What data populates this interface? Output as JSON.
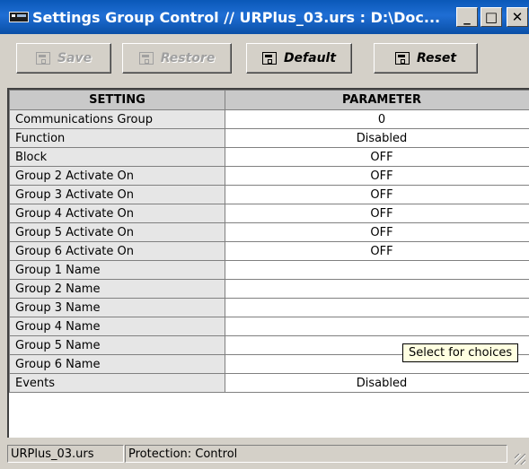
{
  "window": {
    "title": "Settings Group Control // URPlus_03.urs : D:\\Doc...",
    "minimize_label": "_",
    "maximize_label": "□",
    "close_label": "✕"
  },
  "toolbar": {
    "save_label": "Save",
    "restore_label": "Restore",
    "default_label": "Default",
    "reset_label": "Reset"
  },
  "grid": {
    "headers": [
      "SETTING",
      "PARAMETER"
    ],
    "rows": [
      {
        "setting": "Communications Group",
        "parameter": "0"
      },
      {
        "setting": "Function",
        "parameter": "Disabled"
      },
      {
        "setting": "Block",
        "parameter": "OFF"
      },
      {
        "setting": "Group 2 Activate On",
        "parameter": "OFF"
      },
      {
        "setting": "Group 3 Activate On",
        "parameter": "OFF"
      },
      {
        "setting": "Group 4 Activate On",
        "parameter": "OFF"
      },
      {
        "setting": "Group 5 Activate On",
        "parameter": "OFF"
      },
      {
        "setting": "Group 6 Activate On",
        "parameter": "OFF"
      },
      {
        "setting": "Group 1 Name",
        "parameter": ""
      },
      {
        "setting": "Group 2 Name",
        "parameter": ""
      },
      {
        "setting": "Group 3 Name",
        "parameter": ""
      },
      {
        "setting": "Group 4 Name",
        "parameter": ""
      },
      {
        "setting": "Group 5 Name",
        "parameter": ""
      },
      {
        "setting": "Group 6 Name",
        "parameter": ""
      },
      {
        "setting": "Events",
        "parameter": "Disabled"
      }
    ]
  },
  "tooltip": {
    "text": "Select for choices"
  },
  "status": {
    "file": "URPlus_03.urs",
    "section": "Protection: Control"
  }
}
